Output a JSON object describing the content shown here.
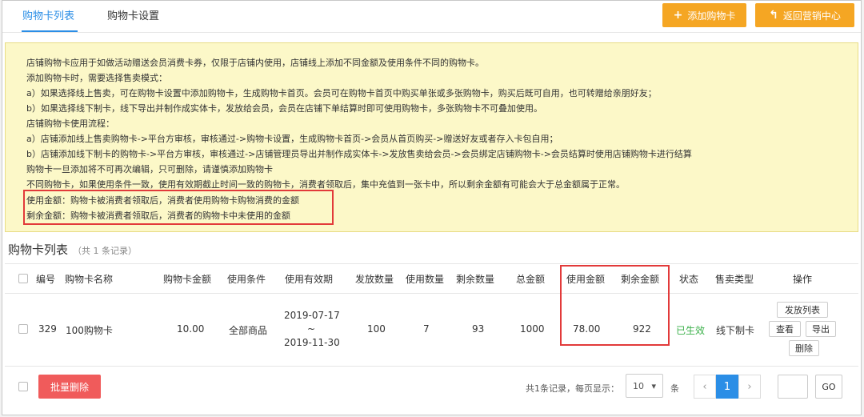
{
  "tabs": [
    {
      "label": "购物卡列表",
      "active": true
    },
    {
      "label": "购物卡设置",
      "active": false
    }
  ],
  "actions": {
    "add_label": "添加购物卡",
    "back_label": "返回营销中心"
  },
  "notice": {
    "lines": [
      "店铺购物卡应用于如做活动赠送会员消费卡券，仅限于店铺内使用，店铺线上添加不同金额及使用条件不同的购物卡。",
      "添加购物卡时，需要选择售卖模式：",
      "a）如果选择线上售卖，可在购物卡设置中添加购物卡，生成购物卡首页。会员可在购物卡首页中购买单张或多张购物卡，购买后既可自用，也可转赠给亲朋好友；",
      "b）如果选择线下制卡，线下导出并制作成实体卡，发放给会员，会员在店铺下单结算时即可使用购物卡，多张购物卡不可叠加使用。",
      "店铺购物卡使用流程：",
      "a）店铺添加线上售卖购物卡->平台方审核，审核通过->购物卡设置，生成购物卡首页->会员从首页购买->赠送好友或者存入卡包自用；",
      "b）店铺添加线下制卡的购物卡->平台方审核，审核通过->店铺管理员导出并制作成实体卡->发放售卖给会员->会员绑定店铺购物卡->会员结算时使用店铺购物卡进行结算",
      "购物卡一旦添加将不可再次编辑，只可删除，请谨慎添加购物卡",
      "不同购物卡，如果使用条件一致，使用有效期截止时间一致的购物卡，消费者领取后，集中充值到一张卡中，所以剩余金额有可能会大于总金额属于正常。",
      "使用金额：购物卡被消费者领取后，消费者使用购物卡购物消费的金额",
      "剩余金额：购物卡被消费者领取后，消费者的购物卡中未使用的金额"
    ]
  },
  "list": {
    "title": "购物卡列表",
    "count_text": "（共 1 条记录）",
    "headers": [
      "编号",
      "购物卡名称",
      "购物卡金额",
      "使用条件",
      "使用有效期",
      "发放数量",
      "使用数量",
      "剩余数量",
      "总金额",
      "使用金额",
      "剩余金额",
      "状态",
      "售卖类型",
      "操作"
    ],
    "rows": [
      {
        "id": "329",
        "name": "100购物卡",
        "amount": "10.00",
        "condition": "全部商品",
        "valid_start": "2019-07-17",
        "valid_sep": "~",
        "valid_end": "2019-11-30",
        "issued": "100",
        "used": "7",
        "remaining": "93",
        "total": "1000",
        "used_amount": "78.00",
        "remaining_amount": "922",
        "status": "已生效",
        "sale_type": "线下制卡",
        "ops": {
          "issue_list": "发放列表",
          "view": "查看",
          "export": "导出",
          "delete": "删除"
        }
      }
    ]
  },
  "footer": {
    "batch_delete": "批量删除",
    "records_text": "共1条记录，每页显示：",
    "per_page": "10",
    "unit": "条",
    "prev": "‹",
    "current_page": "1",
    "next": "›",
    "go_label": "GO"
  },
  "colors": {
    "accent": "#2b8ee6",
    "orange": "#f5a623",
    "danger": "#f05b5b",
    "highlight": "#e23a3a",
    "notice_bg": "#fcf8c8",
    "status_active": "#3bb04a"
  }
}
